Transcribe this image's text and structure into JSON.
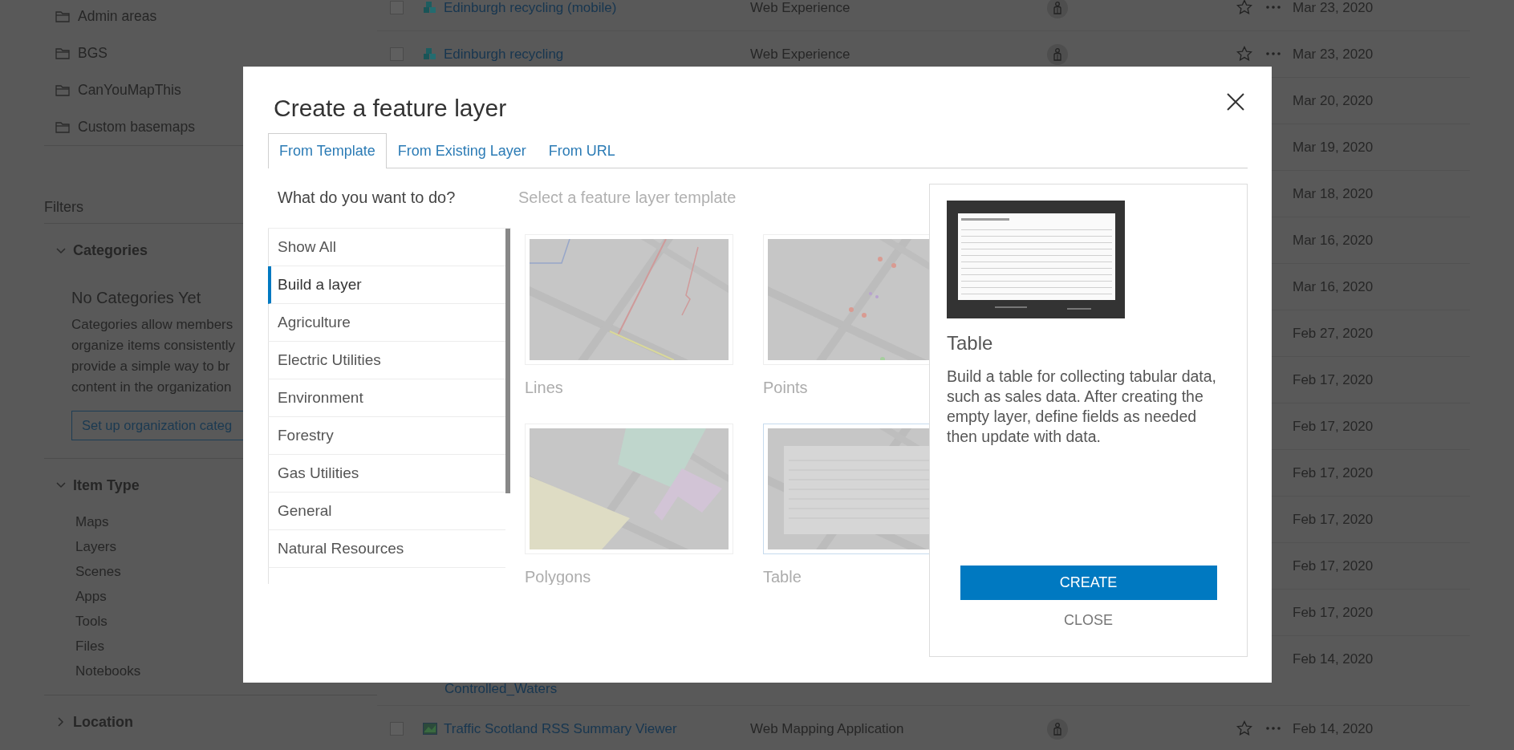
{
  "background": {
    "sidebar": {
      "folders": [
        "Admin areas",
        "BGS",
        "CanYouMapThis",
        "Custom basemaps"
      ],
      "filters_title": "Filters",
      "sections": [
        {
          "kind": "categories",
          "title": "Categories",
          "expanded": true,
          "heading": "No Categories Yet",
          "lines": [
            "Categories allow members",
            "organize items consistently",
            "provide a simple way to br",
            "content in the organization"
          ],
          "button": "Set up organization categ"
        },
        {
          "kind": "list",
          "title": "Item Type",
          "expanded": true,
          "items": [
            "Maps",
            "Layers",
            "Scenes",
            "Apps",
            "Tools",
            "Files",
            "Notebooks"
          ]
        },
        {
          "kind": "list",
          "title": "Location",
          "expanded": false
        }
      ]
    },
    "rows": [
      {
        "kind": "web-experience",
        "checked": false,
        "title": "Edinburgh recycling (mobile)",
        "type": "Web Experience",
        "date": "Mar 23, 2020"
      },
      {
        "kind": "web-experience",
        "checked": false,
        "title": "Edinburgh recycling",
        "type": "Web Experience",
        "date": "Mar 23, 2020"
      },
      {
        "date": "Mar 20, 2020"
      },
      {
        "date": "Mar 19, 2020"
      },
      {
        "date": "Mar 18, 2020"
      },
      {
        "date": "Mar 16, 2020"
      },
      {
        "date": "Mar 16, 2020"
      },
      {
        "date": "Feb 27, 2020"
      },
      {
        "date": "Feb 17, 2020"
      },
      {
        "date": "Feb 17, 2020"
      },
      {
        "date": "Feb 17, 2020"
      },
      {
        "date": "Feb 17, 2020"
      },
      {
        "date": "Feb 17, 2020"
      },
      {
        "date": "Feb 17, 2020"
      },
      {
        "title_tail": "Controlled_Waters",
        "date": "Feb 14, 2020"
      },
      {
        "kind": "web-app",
        "checked": false,
        "title": "Traffic Scotland RSS Summary Viewer",
        "type": "Web Mapping Application",
        "date": "Feb 14, 2020"
      }
    ]
  },
  "modal": {
    "title": "Create a feature layer",
    "tabs": [
      {
        "label": "From Template",
        "selected": true
      },
      {
        "label": "From Existing Layer",
        "selected": false
      },
      {
        "label": "From URL",
        "selected": false
      }
    ],
    "question": "What do you want to do?",
    "search": {
      "placeholder": "Select a feature layer template"
    },
    "categories": [
      {
        "label": "Show All",
        "selected": false
      },
      {
        "label": "Build a layer",
        "selected": true
      },
      {
        "label": "Agriculture",
        "selected": false
      },
      {
        "label": "Electric Utilities",
        "selected": false
      },
      {
        "label": "Environment",
        "selected": false
      },
      {
        "label": "Forestry",
        "selected": false
      },
      {
        "label": "Gas Utilities",
        "selected": false
      },
      {
        "label": "General",
        "selected": false
      },
      {
        "label": "Natural Resources",
        "selected": false
      }
    ],
    "templates": [
      {
        "kind": "lines",
        "label": "Lines",
        "selected": false
      },
      {
        "kind": "points",
        "label": "Points",
        "selected": false
      },
      {
        "kind": "polygons",
        "label": "Polygons",
        "selected": false
      },
      {
        "kind": "table",
        "label": "Table",
        "selected": true
      }
    ],
    "detail": {
      "kind": "table",
      "title": "Table",
      "description": "Build a table for collecting tabular data, such as sales data. After creating the empty layer, define fields as needed then update with data.",
      "create": "CREATE",
      "close": "CLOSE"
    }
  }
}
